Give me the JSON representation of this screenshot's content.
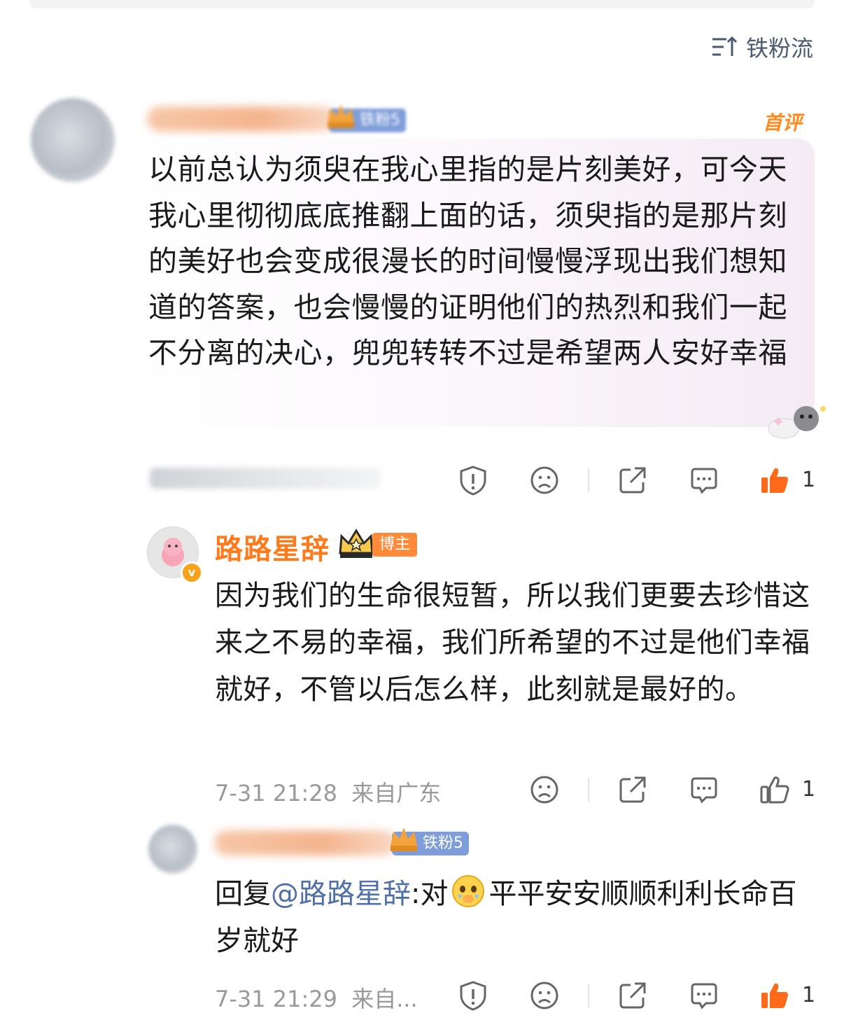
{
  "header": {
    "sort_label": "铁粉流"
  },
  "comment1": {
    "fan_badge": "铁粉5",
    "tag": "首评",
    "text": "以前总认为须臾在我心里指的是片刻美好，可今天我心里彻彻底底推翻上面的话，须臾指的是那片刻的美好也会变成很漫长的时间慢慢浮现出我们想知道的答案，也会慢慢的证明他们的热烈和我们一起不分离的决心，兜兜转转不过是希望两人安好幸福",
    "like_count": "1"
  },
  "reply1": {
    "author": "路路星辞",
    "role_badge": "博主",
    "verified_icon": "v",
    "text": "因为我们的生命很短暂，所以我们更要去珍惜这来之不易的幸福，我们所希望的不过是他们幸福就好，不管以后怎么样，此刻就是最好的。",
    "time": "7-31 21:28",
    "location": "来自广东",
    "like_count": "1"
  },
  "reply2": {
    "fan_badge": "铁粉5",
    "prefix": "回复",
    "mention": "@路路星辞",
    "colon_text": ":对",
    "text": "平平安安顺顺利利长命百岁就好",
    "time": "7-31 21:29",
    "location": "来自...",
    "like_count": "1"
  },
  "colors": {
    "accent_orange": "#ff7a1a",
    "like_orange": "#ff6a1a",
    "mention_blue": "#4f6fa8",
    "fan_badge_blue": "#7e9dd9"
  }
}
